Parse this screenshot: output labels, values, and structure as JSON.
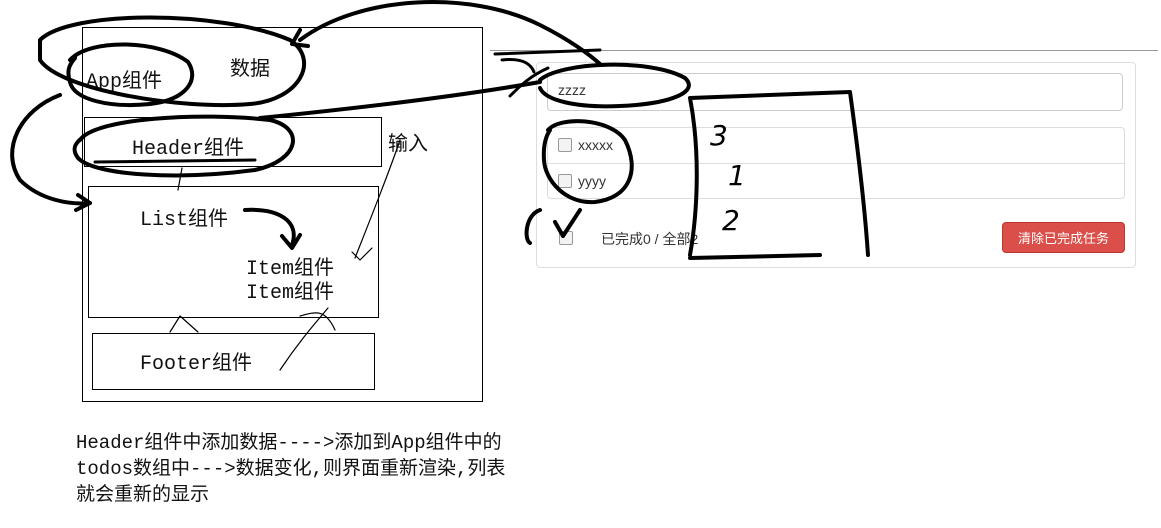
{
  "diagram": {
    "app_label": "App组件",
    "data_label": "数据",
    "header_label": "Header组件",
    "input_label": "输入",
    "list_label": "List组件",
    "item_label_1": "Item组件",
    "item_label_2": "Item组件",
    "footer_label": "Footer组件",
    "note_line_1": "Header组件中添加数据---->添加到App组件中的",
    "note_line_2": "todos数组中--->数据变化,则界面重新渲染,列表",
    "note_line_3": "就会重新的显示"
  },
  "todo_app": {
    "input_value": "zzzz",
    "items": [
      {
        "label": "xxxxx",
        "checked": false
      },
      {
        "label": "yyyy",
        "checked": false
      }
    ],
    "footer_status": "已完成0 / 全部2",
    "clear_button": "清除已完成任务"
  },
  "annotations": {
    "num_3": "3",
    "num_1": "1",
    "num_2": "2"
  },
  "colors": {
    "danger_button": "#da4f49",
    "ink": "#000000"
  }
}
